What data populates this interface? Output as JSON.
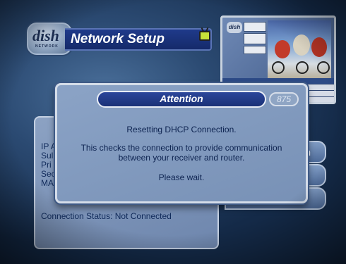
{
  "header": {
    "logo_text_main": "dish",
    "logo_text_sub": "NETWORK",
    "title": "Network Setup"
  },
  "icons": {
    "tv": "tv-icon"
  },
  "preview": {
    "logo": "dish"
  },
  "dialog": {
    "title": "Attention",
    "code": "875",
    "line1": "Resetting DHCP Connection.",
    "line2": "This checks the connection to provide communication between your receiver and router.",
    "line3": "Please wait."
  },
  "panel": {
    "partial_labels": [
      "IP A",
      "Sul",
      "Pri",
      "Sec",
      "MA"
    ],
    "status_label": "Connection Status:",
    "status_value": "Not Connected"
  },
  "side_buttons": [
    "on",
    "",
    ""
  ],
  "colors": {
    "dialog_title_bg": "#1b3177",
    "panel_text": "#102a5a",
    "background": "#2b4a72"
  }
}
